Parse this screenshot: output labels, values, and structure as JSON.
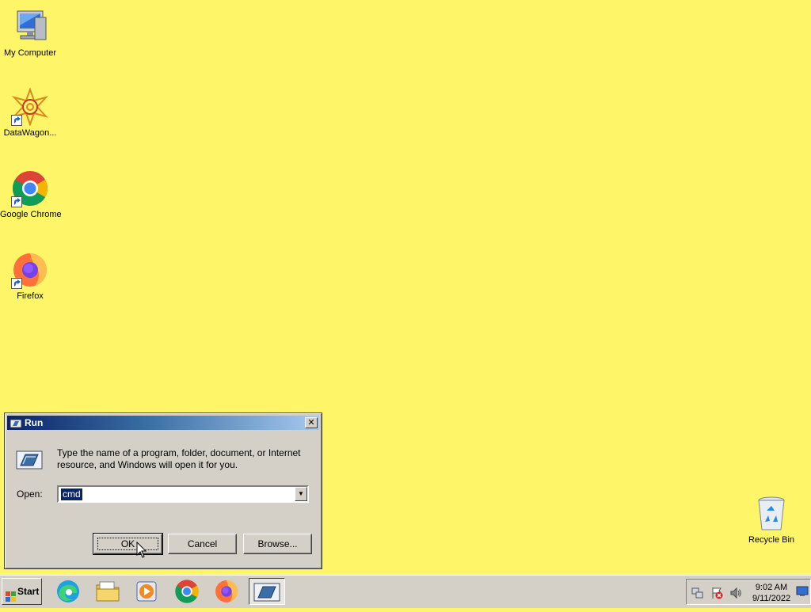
{
  "desktop": {
    "icons": [
      {
        "label": "My Computer",
        "icon": "computer-icon"
      },
      {
        "label": "DataWagon...",
        "icon": "datawagon-icon"
      },
      {
        "label": "Google Chrome",
        "icon": "chrome-icon"
      },
      {
        "label": "Firefox",
        "icon": "firefox-icon"
      }
    ],
    "recycle_bin": {
      "label": "Recycle Bin",
      "icon": "recycle-bin-icon"
    }
  },
  "run_dialog": {
    "title": "Run",
    "description": "Type the name of a program, folder, document, or Internet resource, and Windows will open it for you.",
    "open_label": "Open:",
    "open_value": "cmd",
    "buttons": {
      "ok": "OK",
      "cancel": "Cancel",
      "browse": "Browse..."
    }
  },
  "taskbar": {
    "start_label": "Start",
    "pinned": [
      "edge-icon",
      "file-explorer-icon",
      "media-player-icon",
      "chrome-icon",
      "firefox-icon",
      "run-icon"
    ],
    "clock": {
      "time": "9:02 AM",
      "date": "9/11/2022"
    }
  },
  "colors": {
    "desktop_bg": "#fff568",
    "title_gradient_start": "#0a246a",
    "title_gradient_end": "#a6caf0",
    "window_face": "#d4d0c8"
  }
}
